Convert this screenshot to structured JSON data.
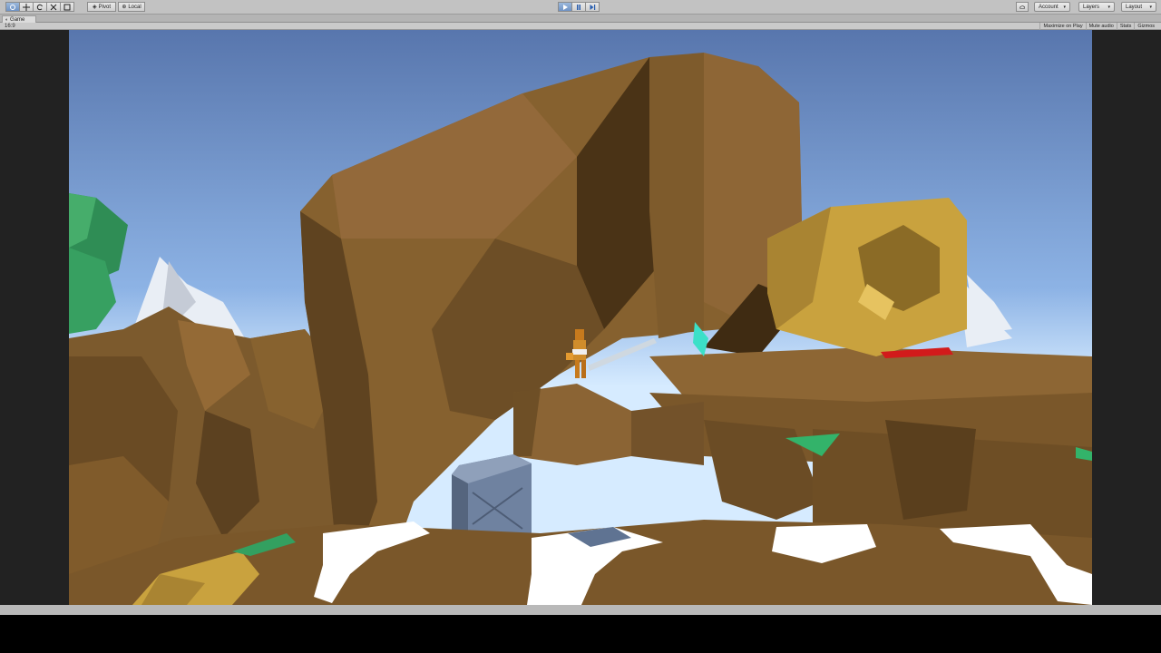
{
  "toolbar": {
    "transform_tools": [
      "hand-tool",
      "move-tool",
      "rotate-tool",
      "scale-tool",
      "rect-tool"
    ],
    "pivot_label": "Pivot",
    "local_label": "Local",
    "play_controls": [
      "play",
      "pause",
      "step"
    ],
    "account_label": "Account",
    "layers_label": "Layers",
    "layout_label": "Layout",
    "cloud_icon": "cloud-icon"
  },
  "game_tab": {
    "label": "Game",
    "aspect": "16:9",
    "buttons": {
      "maximize": "Maximize on Play",
      "mute": "Mute audio",
      "stats": "Stats",
      "gizmos": "Gizmos"
    }
  },
  "colors": {
    "sky_top": "#5b7bb0",
    "sky_bottom": "#cfe4ff",
    "rock": "#8a6130",
    "rock_dark": "#4a3316",
    "gold": "#c9a23e",
    "crate": "#6f82a0",
    "snow": "#ffffff",
    "foliage": "#2f8d55",
    "laser": "#d21b1b",
    "crystal": "#3be0c8"
  }
}
